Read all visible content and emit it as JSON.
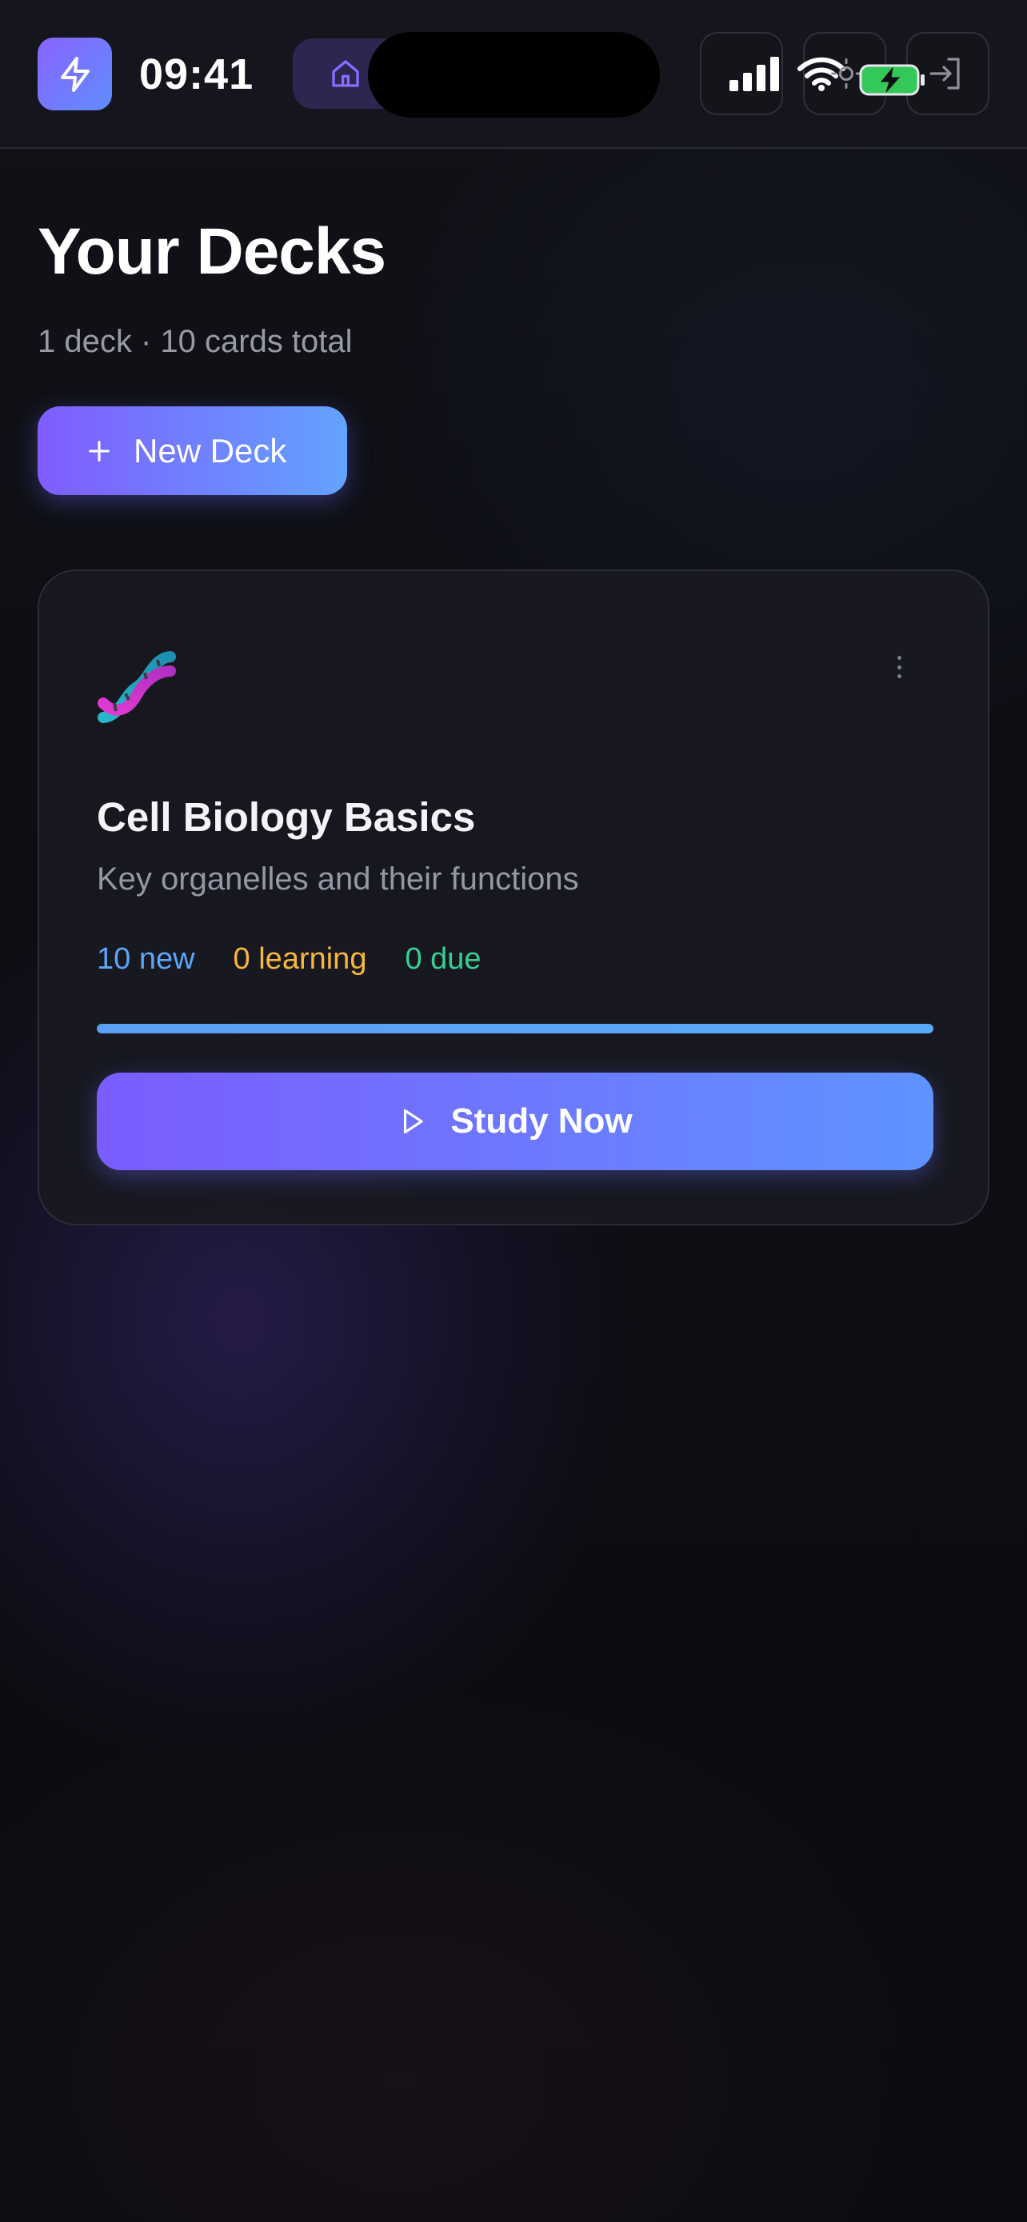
{
  "status_bar": {
    "time": "09:41"
  },
  "header": {
    "title": "Your Decks",
    "subtitle": "1 deck · 10 cards total",
    "new_deck_label": "New Deck"
  },
  "decks": [
    {
      "icon": "dna-emoji",
      "name": "Cell Biology Basics",
      "description": "Key organelles and their functions",
      "stats": {
        "new": "10 new",
        "learning": "0 learning",
        "due": "0 due"
      },
      "progress_new_fraction": 1.0,
      "study_label": "Study Now"
    }
  ],
  "colors": {
    "accent_start": "#7f5cff",
    "accent_end": "#62a3ff",
    "new": "#5ba7f7",
    "learning": "#f6b73c",
    "due": "#36cf93",
    "battery": "#34c759"
  },
  "icons": {
    "app_logo": "lightning-icon",
    "nav_home": "home-icon",
    "signal": "cellular-signal-icon",
    "wifi": "wifi-icon",
    "theme": "sun-icon",
    "battery": "battery-charging-icon",
    "login": "sign-in-icon",
    "menu": "more-vertical-icon",
    "add": "plus-icon",
    "play": "play-icon"
  }
}
